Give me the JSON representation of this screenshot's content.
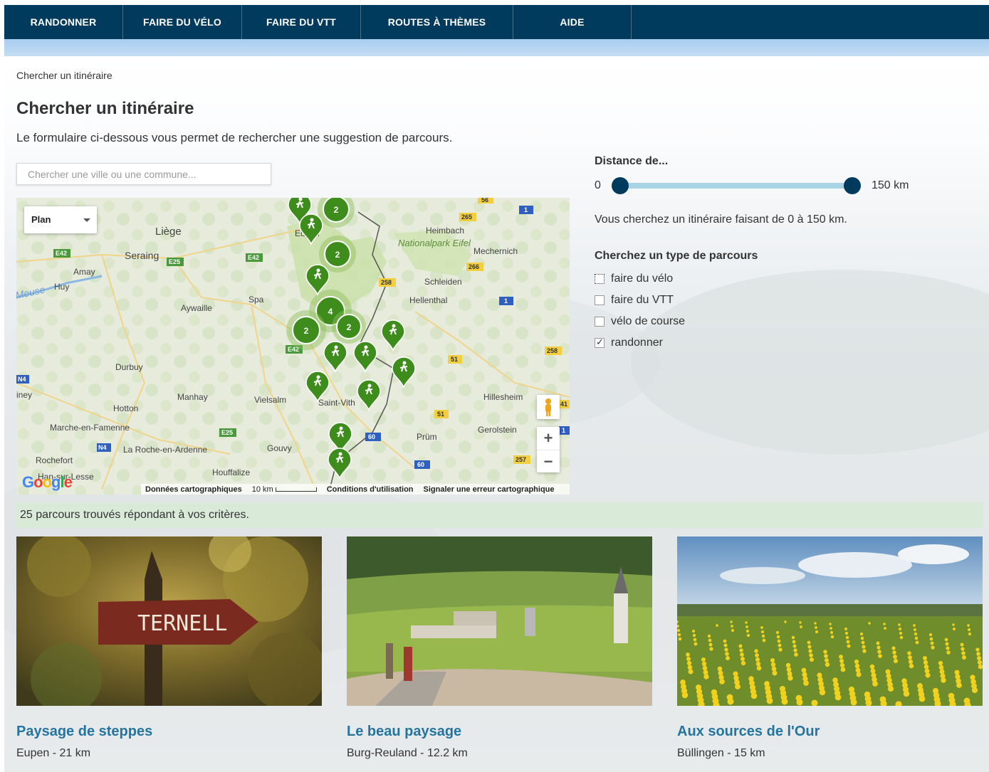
{
  "nav": {
    "items": [
      {
        "label": "RANDONNER"
      },
      {
        "label": "FAIRE DU VÉLO"
      },
      {
        "label": "FAIRE DU VTT"
      },
      {
        "label": "ROUTES À THÈMES"
      },
      {
        "label": "AIDE"
      }
    ]
  },
  "breadcrumb": "Chercher un itinéraire",
  "page": {
    "title": "Chercher un itinéraire",
    "intro": "Le formulaire ci-dessous vous permet de rechercher une suggestion de parcours."
  },
  "search": {
    "placeholder": "Chercher une ville ou une commune..."
  },
  "map": {
    "type_select": "Plan",
    "footer": {
      "data": "Données cartographiques",
      "scale": "10 km",
      "terms": "Conditions d'utilisation",
      "report": "Signaler une erreur cartographique"
    },
    "logo": "Google",
    "places": [
      "Liège",
      "Seraing",
      "Amay",
      "Huy",
      "Meuse",
      "Aywaille",
      "Spa",
      "Eupen",
      "Heimbach",
      "Nationalpark Eifel",
      "Mechernich",
      "Schleiden",
      "Hellenthal",
      "Durbuy",
      "Hotton",
      "Manhay",
      "Vielsalm",
      "Saint-Vith",
      "Hillesheim",
      "Marche-en-Famenne",
      "La Roche-en-Ardenne",
      "Gouvy",
      "Prüm",
      "Gerolstein",
      "Rochefort",
      "Houffalize",
      "Han-sur-Lesse",
      "iney"
    ],
    "roads": [
      "E42",
      "E25",
      "E42",
      "E25",
      "E42",
      "N4",
      "N4",
      "265",
      "266",
      "258",
      "51",
      "51",
      "258",
      "257",
      "60",
      "60",
      "1",
      "1",
      "1",
      "56",
      "41"
    ],
    "clusters": [
      "2",
      "2",
      "4",
      "2",
      "2"
    ]
  },
  "distance": {
    "label": "Distance de...",
    "min": "0",
    "max": "150 km",
    "value_min": 0,
    "value_max": 150,
    "summary": "Vous cherchez un itinéraire faisant de 0 à 150 km."
  },
  "types": {
    "label": "Cherchez un type de parcours",
    "options": [
      {
        "label": "faire du vélo",
        "checked": false
      },
      {
        "label": "faire du VTT",
        "checked": false
      },
      {
        "label": "vélo de course",
        "checked": false
      },
      {
        "label": "randonner",
        "checked": true
      }
    ]
  },
  "results": {
    "text": "25 parcours trouvés répondant à vos critères."
  },
  "cards": [
    {
      "title": "Paysage de steppes",
      "subtitle": "Eupen - 21 km",
      "sign": "TERNELL"
    },
    {
      "title": "Le beau paysage",
      "subtitle": "Burg-Reuland - 12.2 km"
    },
    {
      "title": "Aux sources de l'Our",
      "subtitle": "Büllingen - 15 km"
    }
  ],
  "colors": {
    "nav": "#003a5c",
    "link": "#2474a0",
    "marker": "#3d8c1c",
    "results_bg": "#d9ebd8"
  }
}
